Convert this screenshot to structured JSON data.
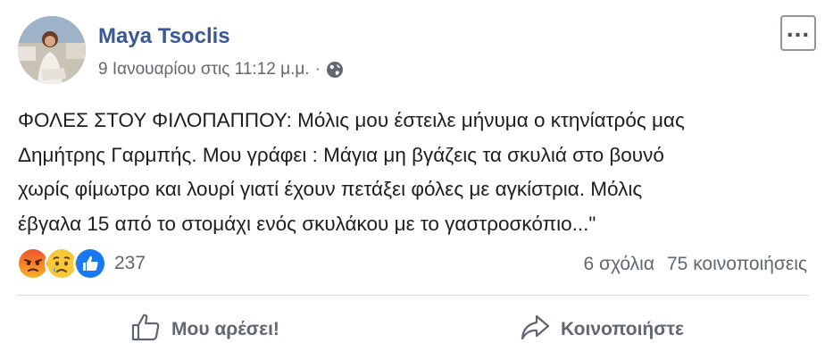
{
  "post": {
    "author": "Maya Tsoclis",
    "timestamp": "9 Ιανουαρίου στις 11:12 μ.μ.",
    "separator": "·",
    "privacy_icon": "globe-icon",
    "text_lines": [
      "ΦΟΛΕΣ ΣΤΟΥ ΦΙΛΟΠΑΠΠΟΥ: Μόλις μου έστειλε μήνυμα ο κτηνίατρός μας",
      "Δημήτρης Γαρμπής. Μου γράφει : Μάγια μη βγάζεις τα σκυλιά στο βουνό",
      "χωρίς φίμωτρο και λουρί γιατί έχουν πετάξει φόλες με αγκίστρια. Μόλις",
      "έβγαλα 15 από το στομάχι ενός σκυλάκου με το γαστροσκόπιο...\""
    ]
  },
  "reactions": {
    "icons": [
      "angry-reaction-icon",
      "sad-reaction-icon",
      "like-reaction-icon"
    ],
    "count": "237"
  },
  "stats": {
    "comments": "6 σχόλια",
    "shares": "75 κοινοποιήσεις"
  },
  "actions": {
    "like_label": "Μου αρέσει!",
    "share_label": "Κοινοποιήστε"
  },
  "colors": {
    "author": "#385898",
    "meta": "#616770",
    "like_blue": "#1877f2",
    "angry": "#f0532f",
    "sad": "#f7c83a"
  }
}
